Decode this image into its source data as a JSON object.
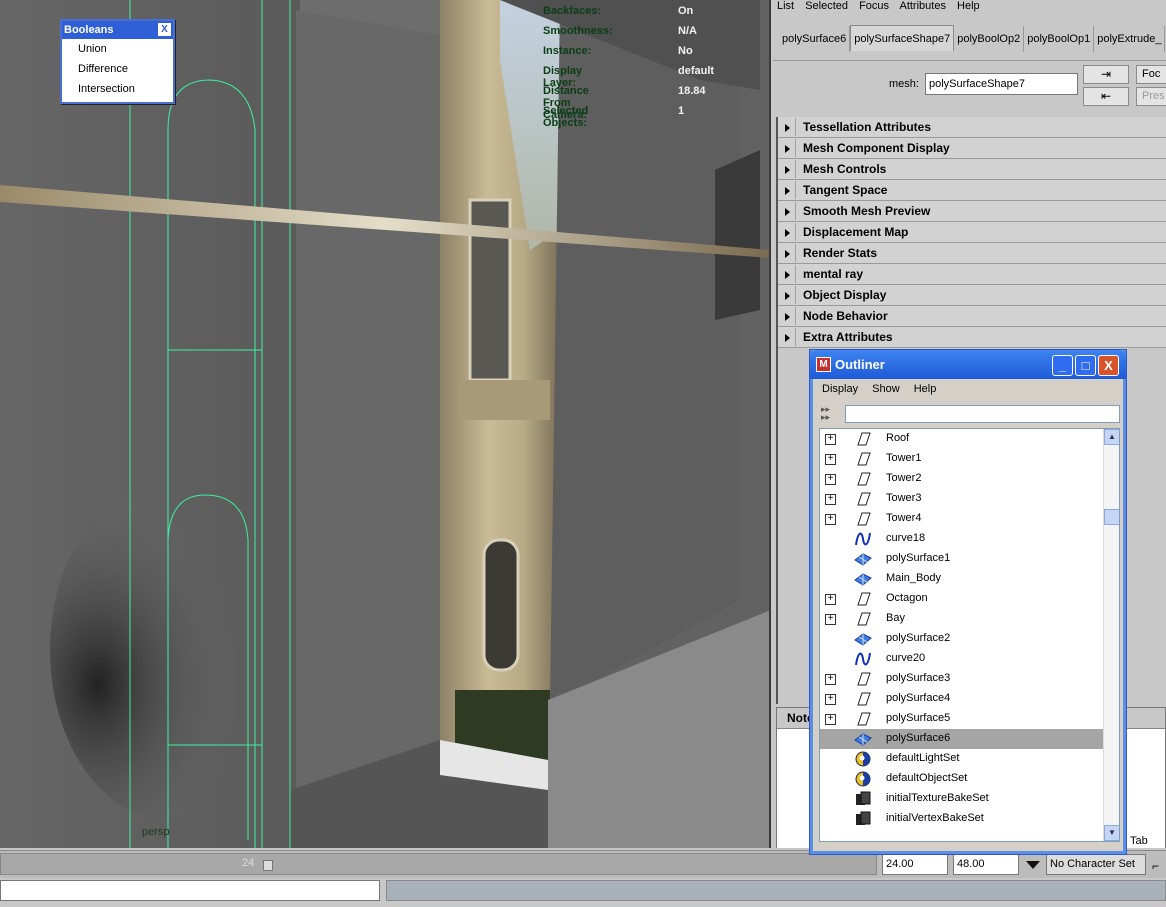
{
  "viewport": {
    "hud": [
      {
        "label": "Backfaces:",
        "value": "On"
      },
      {
        "label": "Smoothness:",
        "value": "N/A"
      },
      {
        "label": "Instance:",
        "value": "No"
      },
      {
        "label": "Display Layer:",
        "value": "default"
      },
      {
        "label": "Distance From Camera:",
        "value": "18.84"
      },
      {
        "label": "Selected Objects:",
        "value": "1"
      }
    ],
    "camera_label": "persp",
    "colors": {
      "background": "#6f6f6f",
      "wireframe": "#3cf0a0",
      "hud_label": "#0a3d16"
    }
  },
  "booleans_panel": {
    "title": "Booleans",
    "close": "X",
    "items": [
      "Union",
      "Difference",
      "Intersection"
    ]
  },
  "attribute_editor": {
    "menu": [
      "List",
      "Selected",
      "Focus",
      "Attributes",
      "Help"
    ],
    "tabs": [
      "polySurface6",
      "polySurfaceShape7",
      "polyBoolOp2",
      "polyBoolOp1",
      "polyExtrude_"
    ],
    "active_tab": "polySurfaceShape7",
    "mesh_label": "mesh:",
    "mesh_value": "polySurfaceShape7",
    "focus_label": "Foc",
    "presets_label": "Pres",
    "sections": [
      "Tessellation Attributes",
      "Mesh Component Display",
      "Mesh Controls",
      "Tangent Space",
      "Smooth Mesh Preview",
      "Displacement Map",
      "Render Stats",
      "mental ray",
      "Object Display",
      "Node Behavior",
      "Extra Attributes"
    ],
    "notes_label": "Note",
    "tab_label": "Tab"
  },
  "outliner": {
    "title": "Outliner",
    "window_buttons": {
      "minimize": "_",
      "maximize": "□",
      "close": "X"
    },
    "menu": [
      "Display",
      "Show",
      "Help"
    ],
    "items": [
      {
        "name": "Roof",
        "icon": "transform-icon",
        "expandable": true,
        "selected": false
      },
      {
        "name": "Tower1",
        "icon": "transform-icon",
        "expandable": true,
        "selected": false
      },
      {
        "name": "Tower2",
        "icon": "transform-icon",
        "expandable": true,
        "selected": false
      },
      {
        "name": "Tower3",
        "icon": "transform-icon",
        "expandable": true,
        "selected": false
      },
      {
        "name": "Tower4",
        "icon": "transform-icon",
        "expandable": true,
        "selected": false
      },
      {
        "name": "curve18",
        "icon": "curve-icon",
        "expandable": false,
        "selected": false
      },
      {
        "name": "polySurface1",
        "icon": "mesh-icon",
        "expandable": false,
        "selected": false
      },
      {
        "name": "Main_Body",
        "icon": "mesh-icon",
        "expandable": false,
        "selected": false
      },
      {
        "name": "Octagon",
        "icon": "transform-icon",
        "expandable": true,
        "selected": false
      },
      {
        "name": "Bay",
        "icon": "transform-icon",
        "expandable": true,
        "selected": false
      },
      {
        "name": "polySurface2",
        "icon": "mesh-icon",
        "expandable": false,
        "selected": false
      },
      {
        "name": "curve20",
        "icon": "curve-icon",
        "expandable": false,
        "selected": false
      },
      {
        "name": "polySurface3",
        "icon": "transform-icon",
        "expandable": true,
        "selected": false
      },
      {
        "name": "polySurface4",
        "icon": "transform-icon",
        "expandable": true,
        "selected": false
      },
      {
        "name": "polySurface5",
        "icon": "transform-icon",
        "expandable": true,
        "selected": false
      },
      {
        "name": "polySurface6",
        "icon": "mesh-icon",
        "expandable": false,
        "selected": true
      },
      {
        "name": "defaultLightSet",
        "icon": "set-icon",
        "expandable": false,
        "selected": false
      },
      {
        "name": "defaultObjectSet",
        "icon": "set-icon",
        "expandable": false,
        "selected": false
      },
      {
        "name": "initialTextureBakeSet",
        "icon": "bake-set-icon",
        "expandable": false,
        "selected": false
      },
      {
        "name": "initialVertexBakeSet",
        "icon": "bake-set-icon",
        "expandable": false,
        "selected": false
      }
    ]
  },
  "timeline": {
    "current_frame": "24",
    "range_start": "24.00",
    "range_end": "48.00",
    "character_set": "No Character Set"
  }
}
